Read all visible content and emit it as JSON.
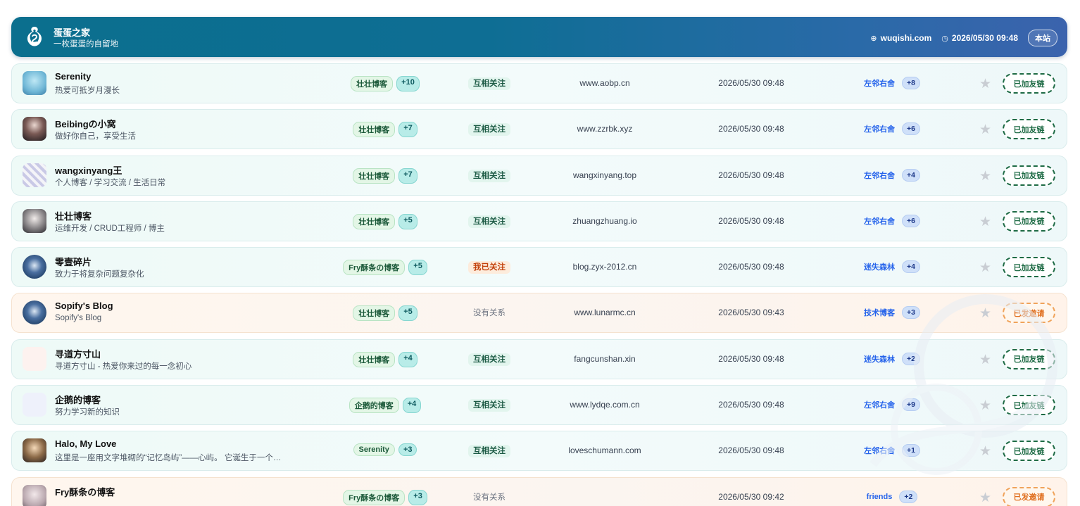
{
  "header": {
    "title": "蛋蛋之家",
    "subtitle": "一枚蛋蛋的自留地",
    "domain": "wuqishi.com",
    "datetime": "2026/05/30 09:48",
    "site_button": "本站",
    "domain_icon": "globe-icon",
    "time_icon": "clock-icon"
  },
  "rows": [
    {
      "name": "Serenity",
      "desc": "热爱可抵岁月漫长",
      "source": "壮壮博客",
      "source_count": "+10",
      "relation": "互相关注",
      "relation_type": "mutual",
      "domain": "www.aobp.cn",
      "time": "2026/05/30 09:48",
      "category": "左邻右舍",
      "category_count": "+8",
      "status": "已加友链",
      "status_type": "added",
      "tone": "cool"
    },
    {
      "name": "Beibingの小窝",
      "desc": "做好你自己，享受生活",
      "source": "壮壮博客",
      "source_count": "+7",
      "relation": "互相关注",
      "relation_type": "mutual",
      "domain": "www.zzrbk.xyz",
      "time": "2026/05/30 09:48",
      "category": "左邻右舍",
      "category_count": "+6",
      "status": "已加友链",
      "status_type": "added",
      "tone": "cool"
    },
    {
      "name": "wangxinyang王",
      "desc": "个人博客 / 学习交流 / 生活日常",
      "source": "壮壮博客",
      "source_count": "+7",
      "relation": "互相关注",
      "relation_type": "mutual",
      "domain": "wangxinyang.top",
      "time": "2026/05/30 09:48",
      "category": "左邻右舍",
      "category_count": "+4",
      "status": "已加友链",
      "status_type": "added",
      "tone": "cool"
    },
    {
      "name": "壮壮博客",
      "desc": "运维开发 / CRUD工程师 / 博主",
      "source": "壮壮博客",
      "source_count": "+5",
      "relation": "互相关注",
      "relation_type": "mutual",
      "domain": "zhuangzhuang.io",
      "time": "2026/05/30 09:48",
      "category": "左邻右舍",
      "category_count": "+6",
      "status": "已加友链",
      "status_type": "added",
      "tone": "cool"
    },
    {
      "name": "零壹碎片",
      "desc": "致力于将复杂问题复杂化",
      "source": "Fry酥条の博客",
      "source_count": "+5",
      "relation": "我已关注",
      "relation_type": "follow",
      "domain": "blog.zyx-2012.cn",
      "time": "2026/05/30 09:48",
      "category": "迷失森林",
      "category_count": "+4",
      "status": "已加友链",
      "status_type": "added",
      "tone": "cool"
    },
    {
      "name": "Sopify's Blog",
      "desc": "Sopify's Blog",
      "source": "壮壮博客",
      "source_count": "+5",
      "relation": "没有关系",
      "relation_type": "none",
      "domain": "www.lunarmc.cn",
      "time": "2026/05/30 09:43",
      "category": "技术博客",
      "category_count": "+3",
      "status": "已发邀请",
      "status_type": "invited",
      "tone": "warm"
    },
    {
      "name": "寻道方寸山",
      "desc": "寻道方寸山 - 热爱你来过的每一念初心",
      "source": "壮壮博客",
      "source_count": "+4",
      "relation": "互相关注",
      "relation_type": "mutual",
      "domain": "fangcunshan.xin",
      "time": "2026/05/30 09:48",
      "category": "迷失森林",
      "category_count": "+2",
      "status": "已加友链",
      "status_type": "added",
      "tone": "cool"
    },
    {
      "name": "企鹅的博客",
      "desc": "努力学习新的知识",
      "source": "企鹅的博客",
      "source_count": "+4",
      "relation": "互相关注",
      "relation_type": "mutual",
      "domain": "www.lydqe.com.cn",
      "time": "2026/05/30 09:48",
      "category": "左邻右舍",
      "category_count": "+9",
      "status": "已加友链",
      "status_type": "added",
      "tone": "cool"
    },
    {
      "name": "Halo, My Love",
      "desc": "这里是一座用文字堆砌的“记忆岛屿”——心屿。 它诞生于一个…",
      "source": "Serenity",
      "source_count": "+3",
      "relation": "互相关注",
      "relation_type": "mutual",
      "domain": "loveschumann.com",
      "time": "2026/05/30 09:48",
      "category": "左邻右舍",
      "category_count": "+1",
      "status": "已加友链",
      "status_type": "added",
      "tone": "cool"
    },
    {
      "name": "Fry酥条の博客",
      "desc": "",
      "source": "Fry酥条の博客",
      "source_count": "+3",
      "relation": "没有关系",
      "relation_type": "none",
      "domain": "",
      "time": "2026/05/30 09:42",
      "category": "friends",
      "category_count": "+2",
      "status": "已发邀请",
      "status_type": "invited",
      "tone": "warm"
    }
  ],
  "star_icon": "star-icon",
  "colors": {
    "header_start": "#0b6f8e",
    "header_end": "#3b63ad",
    "accent_green": "#1e6b45",
    "accent_orange": "#e07020",
    "link_blue": "#2563eb"
  }
}
